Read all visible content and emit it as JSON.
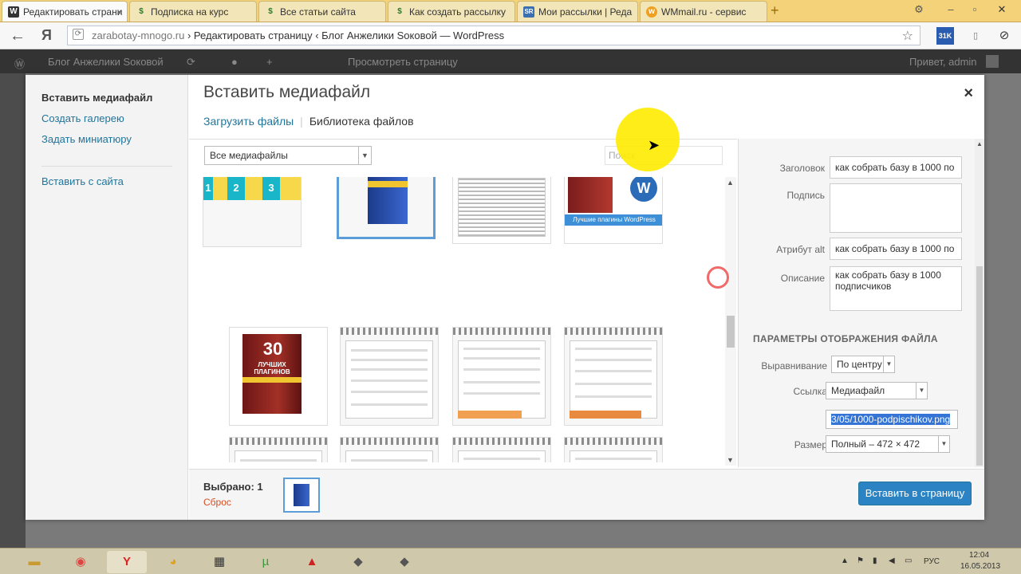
{
  "browser": {
    "tabs": [
      {
        "label": "Редактировать страни",
        "icon": "wordpress-icon"
      },
      {
        "label": "Подписка на курс",
        "icon": "dollar-icon"
      },
      {
        "label": "Все статьи сайта",
        "icon": "dollar-icon"
      },
      {
        "label": "Как создать рассылку",
        "icon": "dollar-icon"
      },
      {
        "label": "Мои рассылки | Реда",
        "icon": "sr-icon"
      },
      {
        "label": "WMmail.ru - сервис",
        "icon": "wmmail-icon"
      }
    ],
    "address_domain": "zarabotay-mnogo.ru",
    "address_rest": " › Редактировать страницу ‹ Блог Анжелики Sоковой — WordPress",
    "extension_badge": "31K"
  },
  "adminbar": {
    "site_name": "Блог Анжелики Sоковой",
    "view_page": "Просмотреть страницу",
    "greeting": "Привет, admin"
  },
  "modal": {
    "title": "Вставить медиафайл",
    "close": "×",
    "menu": {
      "items": [
        "Вставить медиафайл",
        "Создать галерею",
        "Задать миниатюру"
      ],
      "insert_from_url": "Вставить с сайта"
    },
    "router": {
      "upload": "Загрузить файлы",
      "library": "Библиотека файлов"
    },
    "filter_value": "Все медиафайлы",
    "search_placeholder": "Поиск",
    "thumb_labels": {
      "steps": [
        "1",
        "2",
        "3"
      ],
      "plugins_number": "30",
      "plugins_word": "ЛУЧШИХ ПЛАГИНОВ",
      "wp_banner": "Лучшие плагины WordPress"
    },
    "details": {
      "title_label": "Заголовок",
      "title_value": "как собрать базу в 1000 по",
      "caption_label": "Подпись",
      "caption_value": "",
      "alt_label": "Атрибут alt",
      "alt_value": "как собрать базу в 1000 по",
      "desc_label": "Описание",
      "desc_value": "как собрать базу в 1000 подписчиков"
    },
    "display_settings": {
      "heading": "ПАРАМЕТРЫ ОТОБРАЖЕНИЯ ФАЙЛА",
      "align_label": "Выравнивание",
      "align_value": "По центру",
      "link_label": "Ссылка",
      "link_value": "Медиафайл",
      "link_url": "3/05/1000-podpischikov.png",
      "size_label": "Размер",
      "size_value": "Полный – 472 × 472"
    },
    "footer": {
      "selected": "Выбрано: 1",
      "reset": "Сброс",
      "insert_button": "Вставить в страницу"
    }
  },
  "taskbar": {
    "lang": "РУС",
    "time": "12:04",
    "date": "16.05.2013"
  }
}
